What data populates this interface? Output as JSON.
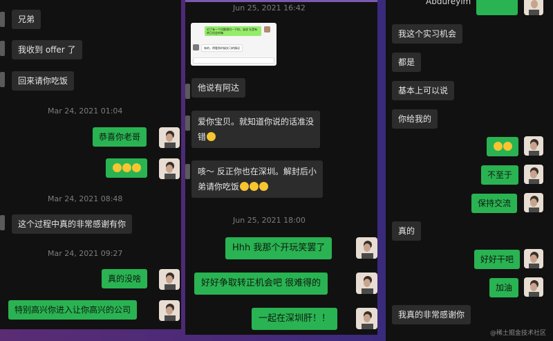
{
  "panel1": {
    "in1": "兄弟",
    "in2": "我收到 offer 了",
    "in3": "回来请你吃饭",
    "ts1": "Mar 24, 2021 01:04",
    "out1": "恭喜你老哥",
    "out2": "😂😂😂",
    "ts2": "Mar 24, 2021 08:48",
    "in4": "这个过程中真的非常感谢有你",
    "ts3": "Mar 24, 2021 09:27",
    "out3": "真的没啥",
    "out4": "特别高兴你进入让你高兴的公司"
  },
  "panel2": {
    "ts1": "Jun 25, 2021 16:42",
    "shot_msg1": "对了有一个问题想问一下你。该说 社是有转正机会的嘛",
    "shot_msg2": "有的，得看到时候实习的情况",
    "in1": "他说有阿达",
    "in2a": "爱你宝贝。就知道你说的话准没",
    "in2b": "错",
    "in3a": "咳～ 反正你也在深圳。解封后小",
    "in3b": "弟请你吃饭",
    "ts2": "Jun 25, 2021 18:00",
    "out1": "Hhh 我那个开玩笑罢了",
    "out2": "好好争取转正机会吧 很难得的",
    "out3": "一起在深圳肝！！"
  },
  "panel3": {
    "header": "Abdureyim 飞书",
    "in1": "我这个实习机会",
    "in2": "都是",
    "in3": "基本上可以说",
    "in4": "你给我的",
    "out1": "😁😂",
    "out2": "不至于",
    "out3": "保持交流",
    "in5": "真的",
    "out4": "好好干吧",
    "out5": "加油",
    "in6": "我真的非常感谢你",
    "watermark": "@稀土掘金技术社区"
  },
  "colors": {
    "outgoing": "#2ab352",
    "incoming": "#2c2c2c",
    "background": "#111111"
  }
}
